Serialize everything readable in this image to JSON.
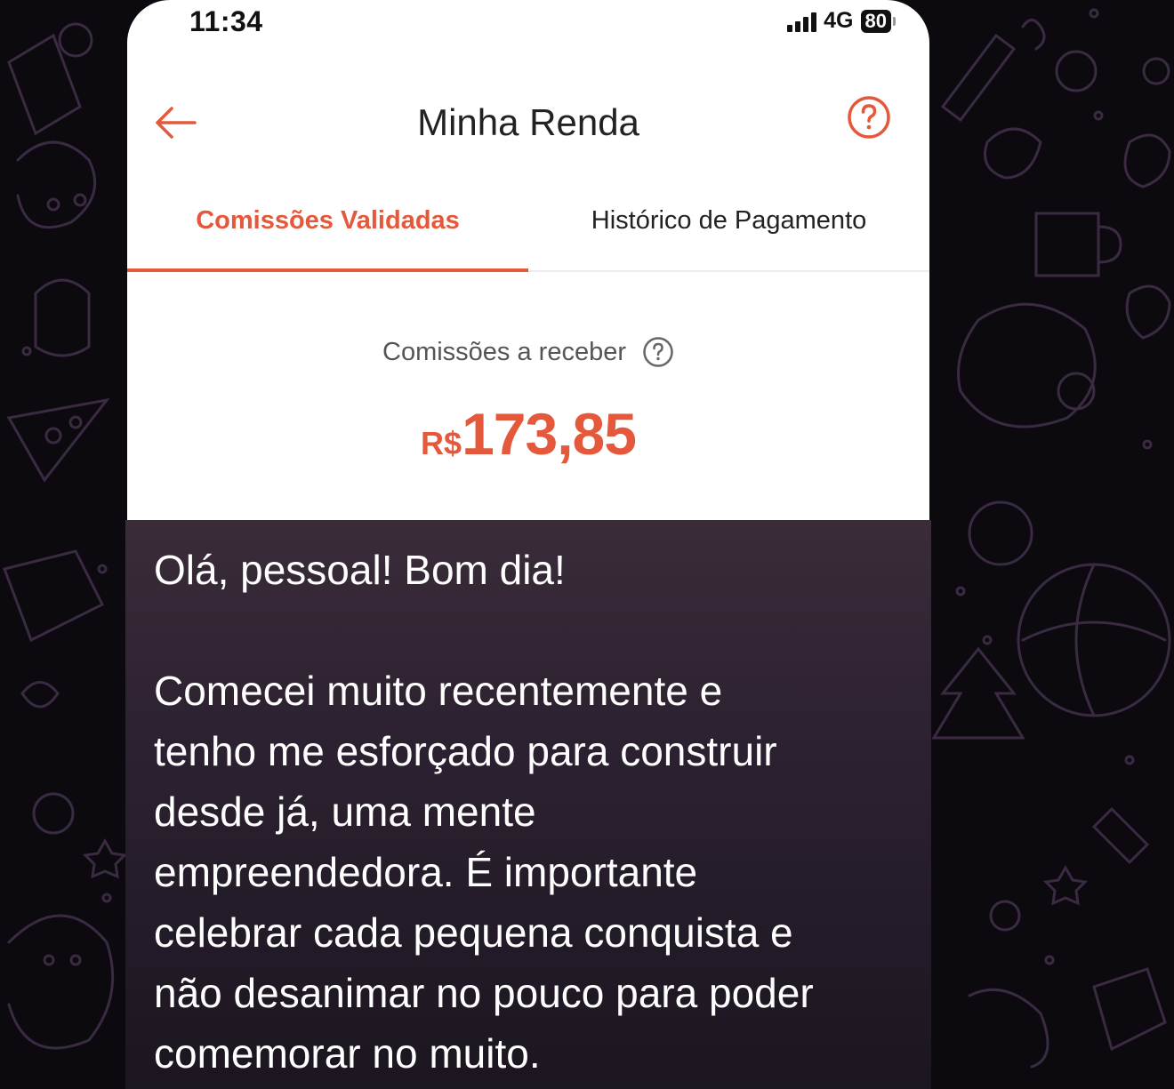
{
  "status_bar": {
    "time": "11:34",
    "network": "4G",
    "battery": "80"
  },
  "header": {
    "title": "Minha Renda"
  },
  "tabs": [
    {
      "label": "Comissões Validadas",
      "active": true
    },
    {
      "label": "Histórico de Pagamento",
      "active": false
    }
  ],
  "commissions": {
    "label": "Comissões a receber",
    "currency": "R$",
    "amount": "173,85"
  },
  "message": {
    "greeting": "Olá, pessoal! Bom dia!",
    "body": "Comecei muito recentemente e\ntenho me esforçado para construir\ndesde já, uma mente\nempreendedora. É importante\ncelebrar cada pequena conquista e\nnão desanimar no pouco para poder\ncomemorar no muito."
  },
  "colors": {
    "accent": "#e4583b",
    "bubble": "#2c2130",
    "wallpaper": "#0d0a0f"
  }
}
